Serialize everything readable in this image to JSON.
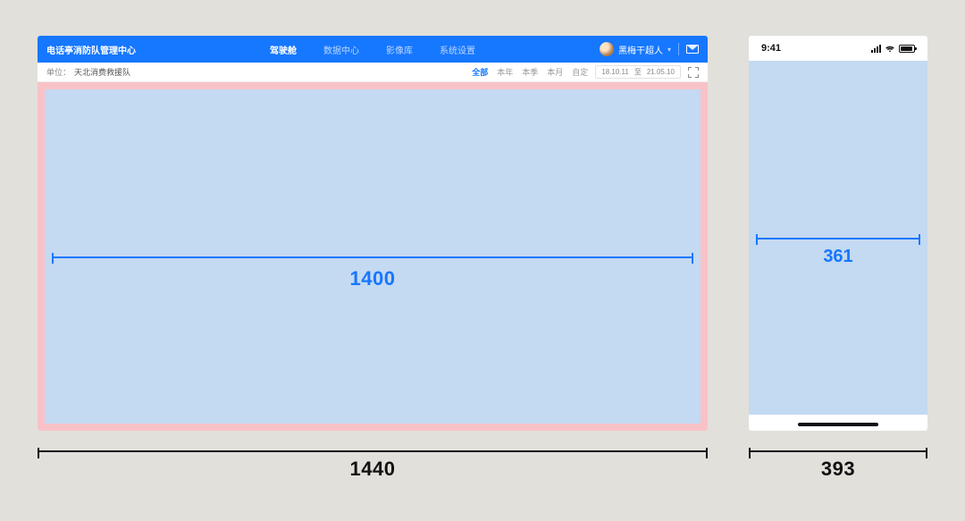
{
  "desktop": {
    "header": {
      "title": "电话亭消防队管理中心",
      "nav": [
        "驾驶舱",
        "数据中心",
        "影像库",
        "系统设置"
      ],
      "user_name": "黑梅干超人"
    },
    "subbar": {
      "unit_label": "单位：",
      "unit_value": "天北消费救援队",
      "tabs": [
        "全部",
        "本年",
        "本季",
        "本月",
        "自定"
      ],
      "date_start": "18.10.11",
      "date_sep": "至",
      "date_end": "21.05.10"
    },
    "inner_width_label": "1400",
    "outer_width_label": "1440"
  },
  "mobile": {
    "time": "9:41",
    "inner_width_label": "361",
    "outer_width_label": "393"
  }
}
